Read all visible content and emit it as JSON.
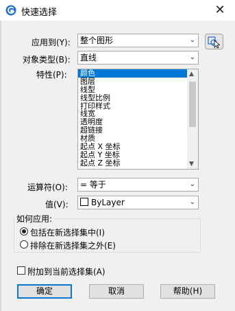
{
  "window": {
    "title": "快速选择",
    "close_glyph": "✕"
  },
  "apply_to": {
    "label": "应用到(Y):",
    "value": "整个图形"
  },
  "object_type": {
    "label": "对象类型(B):",
    "value": "直线"
  },
  "properties": {
    "label": "特性(P):",
    "items": [
      "颜色",
      "图层",
      "线型",
      "线型比例",
      "打印样式",
      "线宽",
      "透明度",
      "超链接",
      "材质",
      "起点 X 坐标",
      "起点 Y 坐标",
      "起点 Z 坐标"
    ],
    "selected_index": 0
  },
  "operator": {
    "label": "运算符(O):",
    "value": "= 等于"
  },
  "value_field": {
    "label": "值(V):",
    "value": "ByLayer"
  },
  "how_to_apply": {
    "title": "如何应用:",
    "options": [
      {
        "label": "包括在新选择集中(I)",
        "selected": true
      },
      {
        "label": "排除在新选择集之外(E)",
        "selected": false
      }
    ]
  },
  "append_checkbox": {
    "label": "附加到当前选择集(A)",
    "checked": false
  },
  "buttons": {
    "ok": "确定",
    "cancel": "取消",
    "help": "帮助(H)"
  },
  "colors": {
    "accent": "#0078d7",
    "icon_blue": "#1e6fd9"
  },
  "chevron_glyph": "⌄"
}
